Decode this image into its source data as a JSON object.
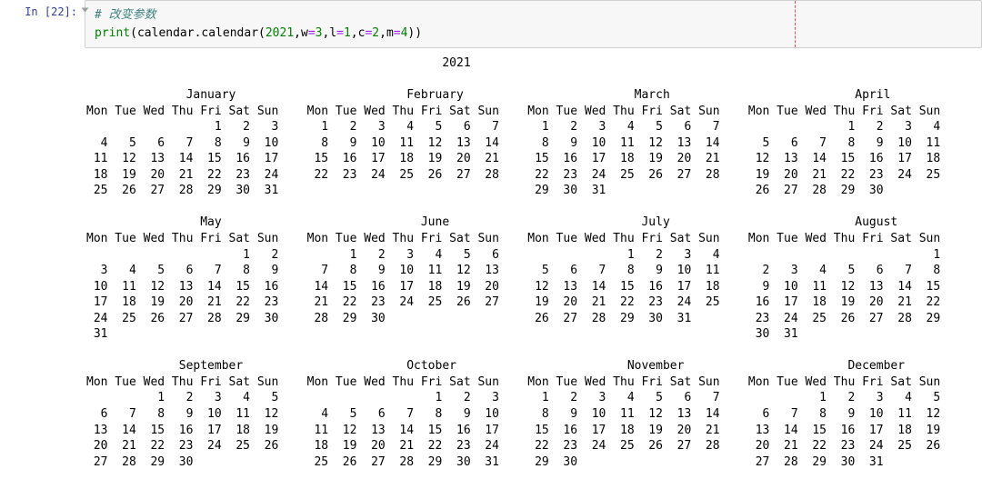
{
  "prompt": "In [22]:",
  "code": {
    "comment": "# 改变参数",
    "blank": "",
    "print_kw": "print",
    "open_paren": "(",
    "func_path": "calendar.calendar(",
    "arg_year": "2021",
    "sep1": ",",
    "kw_w": "w",
    "eq": "=",
    "val_w": "3",
    "sep2": ",",
    "kw_l": "l",
    "val_l": "1",
    "sep3": ",",
    "kw_c": "c",
    "val_c": "2",
    "sep4": ",",
    "kw_m": "m",
    "val_m": "4",
    "close": "))"
  },
  "calendar_output": "                                                  2021\n\n              January                        February                        March                          April\nMon Tue Wed Thu Fri Sat Sun    Mon Tue Wed Thu Fri Sat Sun    Mon Tue Wed Thu Fri Sat Sun    Mon Tue Wed Thu Fri Sat Sun\n                  1   2   3      1   2   3   4   5   6   7      1   2   3   4   5   6   7                  1   2   3   4\n  4   5   6   7   8   9  10      8   9  10  11  12  13  14      8   9  10  11  12  13  14      5   6   7   8   9  10  11\n 11  12  13  14  15  16  17     15  16  17  18  19  20  21     15  16  17  18  19  20  21     12  13  14  15  16  17  18\n 18  19  20  21  22  23  24     22  23  24  25  26  27  28     22  23  24  25  26  27  28     19  20  21  22  23  24  25\n 25  26  27  28  29  30  31                                    29  30  31                     26  27  28  29  30\n\n                May                            June                           July                          August\nMon Tue Wed Thu Fri Sat Sun    Mon Tue Wed Thu Fri Sat Sun    Mon Tue Wed Thu Fri Sat Sun    Mon Tue Wed Thu Fri Sat Sun\n                      1   2          1   2   3   4   5   6                  1   2   3   4                              1\n  3   4   5   6   7   8   9      7   8   9  10  11  12  13      5   6   7   8   9  10  11      2   3   4   5   6   7   8\n 10  11  12  13  14  15  16     14  15  16  17  18  19  20     12  13  14  15  16  17  18      9  10  11  12  13  14  15\n 17  18  19  20  21  22  23     21  22  23  24  25  26  27     19  20  21  22  23  24  25     16  17  18  19  20  21  22\n 24  25  26  27  28  29  30     28  29  30                     26  27  28  29  30  31         23  24  25  26  27  28  29\n 31                                                                                           30  31\n\n             September                       October                        November                       December\nMon Tue Wed Thu Fri Sat Sun    Mon Tue Wed Thu Fri Sat Sun    Mon Tue Wed Thu Fri Sat Sun    Mon Tue Wed Thu Fri Sat Sun\n          1   2   3   4   5                      1   2   3      1   2   3   4   5   6   7              1   2   3   4   5\n  6   7   8   9  10  11  12      4   5   6   7   8   9  10      8   9  10  11  12  13  14      6   7   8   9  10  11  12\n 13  14  15  16  17  18  19     11  12  13  14  15  16  17     15  16  17  18  19  20  21     13  14  15  16  17  18  19\n 20  21  22  23  24  25  26     18  19  20  21  22  23  24     22  23  24  25  26  27  28     20  21  22  23  24  25  26\n 27  28  29  30                 25  26  27  28  29  30  31     29  30                         27  28  29  30  31\n"
}
